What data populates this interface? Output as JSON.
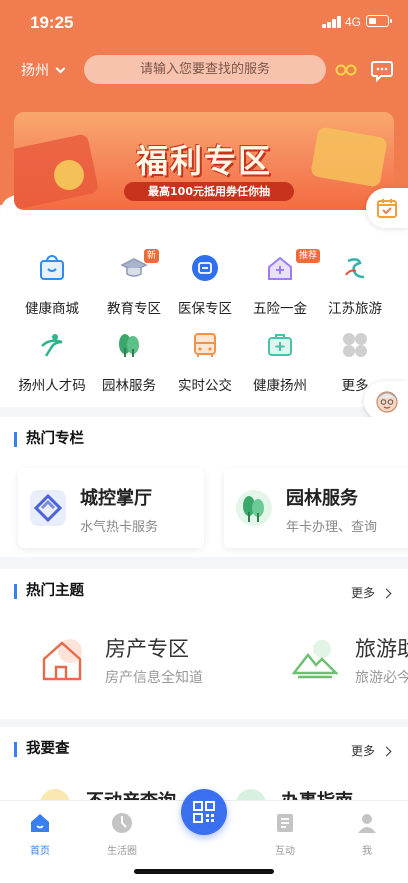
{
  "status": {
    "time": "19:25",
    "network": "4G"
  },
  "header": {
    "city": "扬州",
    "search_placeholder": "请输入您要查找的服务"
  },
  "banner": {
    "title": "福利专区",
    "subtitle": "最高100元抵用券任你抽"
  },
  "services": [
    {
      "label": "健康商城",
      "icon": "health-mall-icon",
      "color": "#2f8cf0"
    },
    {
      "label": "教育专区",
      "icon": "graduation-cap-icon",
      "badge": "新",
      "color": "#8e9bb8"
    },
    {
      "label": "医保专区",
      "icon": "medical-insurance-icon",
      "color": "#2f6ff0"
    },
    {
      "label": "五险一金",
      "icon": "house-plus-icon",
      "badge": "推荐",
      "color": "#9b7df0"
    },
    {
      "label": "江苏旅游",
      "icon": "jiangsu-tourism-icon",
      "color": "#2fb5a8"
    },
    {
      "label": "扬州人才码",
      "icon": "talent-code-icon",
      "color": "#2fb58a"
    },
    {
      "label": "园林服务",
      "icon": "tree-icon",
      "color": "#3aa86a"
    },
    {
      "label": "实时公交",
      "icon": "bus-icon",
      "color": "#f0934a"
    },
    {
      "label": "健康扬州",
      "icon": "medical-kit-icon",
      "color": "#4ac0a8"
    },
    {
      "label": "更多",
      "icon": "more-grid-icon",
      "color": "#c8c8c8"
    }
  ],
  "hot_columns": {
    "title": "热门专栏",
    "items": [
      {
        "title": "城控掌厅",
        "subtitle": "水气热卡服务",
        "icon": "chengkong-logo-icon"
      },
      {
        "title": "园林服务",
        "subtitle": "年卡办理、查询",
        "icon": "garden-tree-icon"
      }
    ]
  },
  "hot_topics": {
    "title": "热门主题",
    "more": "更多",
    "items": [
      {
        "title": "房产专区",
        "subtitle": "房产信息全知道",
        "icon": "house-icon"
      },
      {
        "title": "旅游助",
        "subtitle": "旅游必今",
        "icon": "mountain-icon"
      }
    ]
  },
  "i_want_check": {
    "title": "我要查",
    "more": "更多",
    "items": [
      {
        "title": "不动产查询"
      },
      {
        "title": "办事指南"
      }
    ]
  },
  "tabbar": {
    "items": [
      {
        "label": "首页",
        "icon": "home-icon",
        "active": true
      },
      {
        "label": "生活圈",
        "icon": "life-circle-icon"
      },
      {
        "label": "",
        "icon": "qr-code-icon"
      },
      {
        "label": "互动",
        "icon": "interact-icon"
      },
      {
        "label": "我",
        "icon": "user-icon"
      }
    ]
  }
}
